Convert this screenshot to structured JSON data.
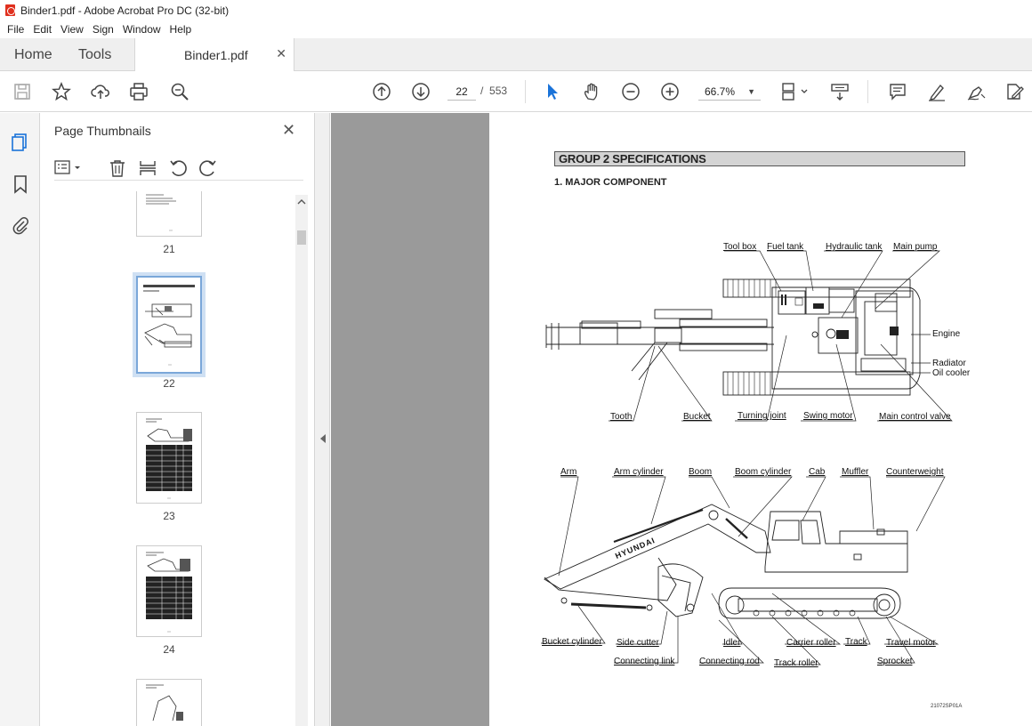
{
  "window": {
    "title": "Binder1.pdf - Adobe Acrobat Pro DC (32-bit)"
  },
  "menu": [
    "File",
    "Edit",
    "View",
    "Sign",
    "Window",
    "Help"
  ],
  "tabs": {
    "home": "Home",
    "tools": "Tools",
    "document": "Binder1.pdf"
  },
  "toolbar": {
    "current_page": "22",
    "page_sep": "/",
    "total_pages": "553",
    "zoom": "66.7%"
  },
  "panel": {
    "title": "Page Thumbnails",
    "thumbnails": [
      {
        "label": "21"
      },
      {
        "label": "22",
        "selected": true
      },
      {
        "label": "23"
      },
      {
        "label": "24"
      },
      {
        "label": ""
      }
    ]
  },
  "document": {
    "group_title": "GROUP  2  SPECIFICATIONS",
    "section_title": "1.  MAJOR COMPONENT",
    "top_labels": {
      "tool_box": "Tool box",
      "fuel_tank": "Fuel tank",
      "hydraulic_tank": "Hydraulic tank",
      "main_pump": "Main pump",
      "engine": "Engine",
      "radiator": "Radiator",
      "oil_cooler": "Oil cooler",
      "tooth": "Tooth",
      "bucket": "Bucket",
      "turning_joint": "Turning joint",
      "swing_motor": "Swing motor",
      "main_control_valve": "Main control valve"
    },
    "side_labels": {
      "arm": "Arm",
      "arm_cylinder": "Arm cylinder",
      "boom": "Boom",
      "boom_cylinder": "Boom cylinder",
      "cab": "Cab",
      "muffler": "Muffler",
      "counterweight": "Counterweight",
      "bucket_cylinder": "Bucket cylinder",
      "side_cutter": "Side cutter",
      "idler": "Idler",
      "carrier_roller": "Carrier roller",
      "track": "Track",
      "travel_motor": "Travel motor",
      "connecting_link": "Connecting link",
      "connecting_rod": "Connecting rod",
      "track_roller": "Track roller",
      "sprocket": "Sprocket"
    },
    "brand": "HYUNDAI",
    "figure_code": "21072SP01A"
  }
}
